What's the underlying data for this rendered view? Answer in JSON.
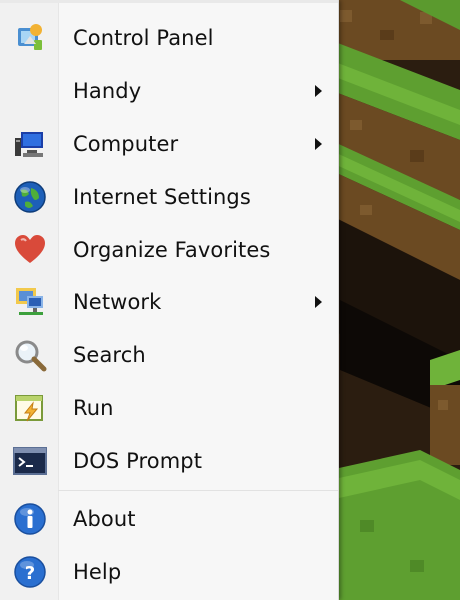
{
  "menu": {
    "items": [
      {
        "label": "Control Panel",
        "icon": "control-panel-icon",
        "submenu": false
      },
      {
        "label": "Handy",
        "icon": "",
        "submenu": true
      },
      {
        "label": "Computer",
        "icon": "computer-icon",
        "submenu": true
      },
      {
        "label": "Internet Settings",
        "icon": "globe-icon",
        "submenu": false
      },
      {
        "label": "Organize Favorites",
        "icon": "heart-icon",
        "submenu": false
      },
      {
        "label": "Network",
        "icon": "network-icon",
        "submenu": true
      },
      {
        "label": "Search",
        "icon": "magnifier-icon",
        "submenu": false
      },
      {
        "label": "Run",
        "icon": "run-icon",
        "submenu": false
      },
      {
        "label": "DOS Prompt",
        "icon": "terminal-icon",
        "submenu": false
      },
      {
        "label": "About",
        "icon": "info-icon",
        "submenu": false
      },
      {
        "label": "Help",
        "icon": "help-icon",
        "submenu": false
      }
    ]
  },
  "colors": {
    "menu_bg": "#f7f7f7",
    "text": "#111111",
    "grass": "#5b9a2e",
    "dirt": "#6b4a22"
  }
}
